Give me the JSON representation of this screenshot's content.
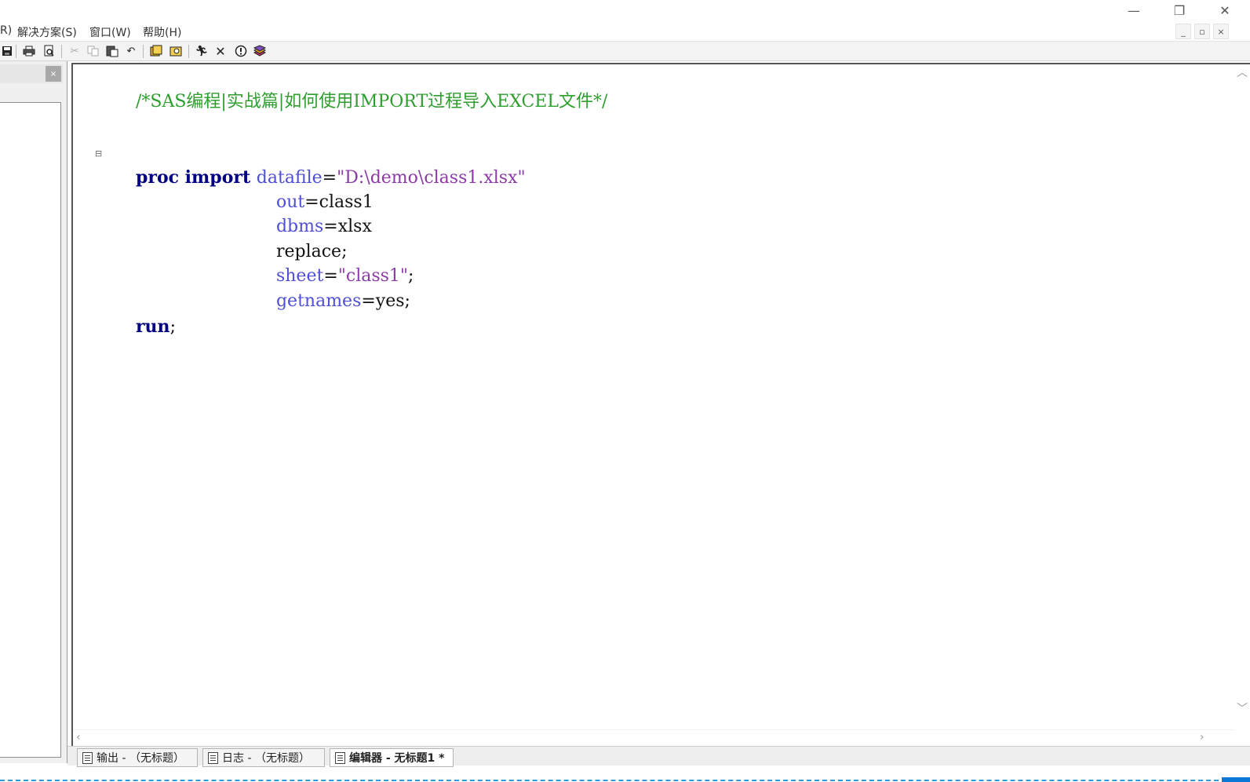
{
  "window": {
    "minimize_glyph": "—",
    "restore_glyph": "❐",
    "close_glyph": "✕"
  },
  "menubar": {
    "items": [
      {
        "label": "R)"
      },
      {
        "label": "解决方案(S)"
      },
      {
        "label": "窗口(W)"
      },
      {
        "label": "帮助(H)"
      }
    ],
    "mdi_minimize": "_",
    "mdi_restore": "▫",
    "mdi_close": "×"
  },
  "toolbar": {
    "icons": [
      "save-icon",
      "print-icon",
      "print-preview-icon",
      "cut-icon",
      "copy-icon",
      "paste-icon",
      "undo-icon",
      "libraries-icon",
      "explorer-icon",
      "run-icon",
      "break-icon",
      "help-icon",
      "documentation-icon"
    ]
  },
  "left_pane": {
    "close_glyph": "×"
  },
  "editor": {
    "fold_marker": "⊟",
    "lines": {
      "l1_comment": "/*SAS编程|实战篇|如何使用IMPORT过程导入EXCEL文件*/",
      "l2_kw": "proc import ",
      "l2_opt": "datafile",
      "l2_eq": "=",
      "l2_str": "\"D:\\demo\\class1.xlsx\"",
      "l3_opt": "out",
      "l3_rest": "=class1",
      "l4_opt": "dbms",
      "l4_rest": "=xlsx",
      "l5_plain": "replace;",
      "l6_opt": "sheet",
      "l6_eq": "=",
      "l6_str": "\"class1\"",
      "l6_semi": ";",
      "l7_opt": "getnames",
      "l7_rest": "=yes;",
      "l8_kw": "run",
      "l8_semi": ";"
    }
  },
  "taskbar": {
    "tabs": [
      {
        "label": "输出 - （无标题）",
        "active": false
      },
      {
        "label": "日志 - （无标题）",
        "active": false
      },
      {
        "label": "编辑器 - 无标题1 *",
        "active": true
      }
    ]
  }
}
